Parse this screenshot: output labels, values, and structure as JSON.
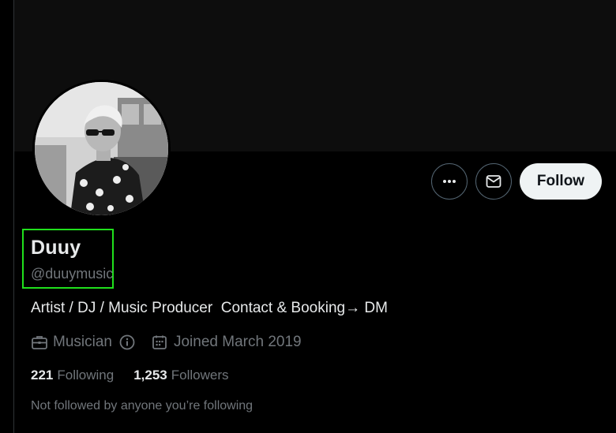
{
  "profile": {
    "display_name": "Duuy",
    "handle": "@duuymusic",
    "bio": "Artist / DJ / Music Producer  Contact & Booking→ DM",
    "category": "Musician",
    "joined": "Joined March 2019",
    "following_count": "221",
    "following_label": "Following",
    "followers_count": "1,253",
    "followers_label": "Followers",
    "not_followed_text": "Not followed by anyone you’re following"
  },
  "actions": {
    "more_icon": "more-horizontal-icon",
    "message_icon": "envelope-icon",
    "follow_label": "Follow"
  },
  "icons": {
    "category": "briefcase-icon",
    "info": "info-icon",
    "joined": "calendar-icon"
  },
  "colors": {
    "background": "#000000",
    "primary_text": "#e7e9ea",
    "secondary_text": "#71767b",
    "follow_button_bg": "#eff3f4",
    "highlight": "#20e01c"
  }
}
